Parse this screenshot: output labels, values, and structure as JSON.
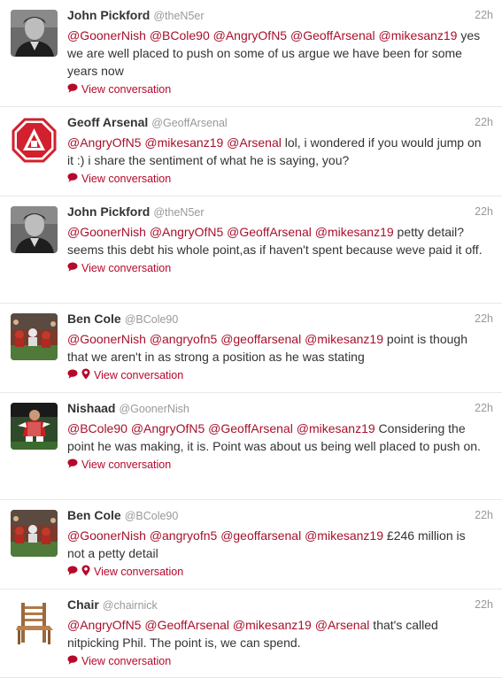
{
  "colors": {
    "accent": "#b6082b",
    "mention": "#a8102b",
    "meta": "#999999",
    "text": "#333333"
  },
  "footer_label": "View conversation",
  "tweets": [
    {
      "name": "John Pickford",
      "handle": "@theN5er",
      "time": "22h",
      "avatar": "player-bw-photo",
      "text": [
        [
          "m",
          "@GoonerNish"
        ],
        [
          "t",
          " "
        ],
        [
          "m",
          "@BCole90"
        ],
        [
          "t",
          " "
        ],
        [
          "m",
          "@AngryOfN5"
        ],
        [
          "t",
          " "
        ],
        [
          "m",
          "@GeoffArsenal"
        ],
        [
          "t",
          " "
        ],
        [
          "m",
          "@mikesanz19"
        ],
        [
          "t",
          " yes we are well placed to push on some of us argue we have been for some years now"
        ]
      ],
      "icons": [
        "conversation-icon"
      ]
    },
    {
      "name": "Geoff Arsenal",
      "handle": "@GeoffArsenal",
      "time": "22h",
      "avatar": "cannon-crest-logo",
      "text": [
        [
          "m",
          "@AngryOfN5"
        ],
        [
          "t",
          " "
        ],
        [
          "m",
          "@mikesanz19"
        ],
        [
          "t",
          " "
        ],
        [
          "m",
          "@Arsenal"
        ],
        [
          "t",
          " lol, i wondered if you would jump on it :) i share the sentiment of what he is saying, you?"
        ]
      ],
      "icons": [
        "conversation-icon"
      ]
    },
    {
      "name": "John Pickford",
      "handle": "@theN5er",
      "time": "22h",
      "avatar": "player-bw-photo",
      "text": [
        [
          "m",
          "@GoonerNish"
        ],
        [
          "t",
          " "
        ],
        [
          "m",
          "@AngryOfN5"
        ],
        [
          "t",
          " "
        ],
        [
          "m",
          "@GeoffArsenal"
        ],
        [
          "t",
          " "
        ],
        [
          "m",
          "@mikesanz19"
        ],
        [
          "t",
          " petty detail? seems this debt his whole point,as if haven't spent because weve paid it off."
        ]
      ],
      "icons": [
        "conversation-icon"
      ]
    },
    {
      "name": "Ben Cole",
      "handle": "@BCole90",
      "time": "22h",
      "avatar": "stadium-crowd-photo",
      "text": [
        [
          "m",
          "@GoonerNish"
        ],
        [
          "t",
          " "
        ],
        [
          "m",
          "@angryofn5"
        ],
        [
          "t",
          " "
        ],
        [
          "m",
          "@geoffarsenal"
        ],
        [
          "t",
          " "
        ],
        [
          "m",
          "@mikesanz19"
        ],
        [
          "t",
          " point is though that we aren't in as strong a position as he was stating"
        ]
      ],
      "icons": [
        "conversation-icon",
        "location-pin-icon"
      ]
    },
    {
      "name": "Nishaad",
      "handle": "@GoonerNish",
      "time": "22h",
      "avatar": "player-red-kit-photo",
      "text": [
        [
          "m",
          "@BCole90"
        ],
        [
          "t",
          " "
        ],
        [
          "m",
          "@AngryOfN5"
        ],
        [
          "t",
          " "
        ],
        [
          "m",
          "@GeoffArsenal"
        ],
        [
          "t",
          " "
        ],
        [
          "m",
          "@mikesanz19"
        ],
        [
          "t",
          " Considering the point he was making, it is. Point was about us being well placed to push on."
        ]
      ],
      "icons": [
        "conversation-icon"
      ]
    },
    {
      "name": "Ben Cole",
      "handle": "@BCole90",
      "time": "22h",
      "avatar": "stadium-crowd-photo",
      "text": [
        [
          "m",
          "@GoonerNish"
        ],
        [
          "t",
          " "
        ],
        [
          "m",
          "@angryofn5"
        ],
        [
          "t",
          " "
        ],
        [
          "m",
          "@geoffarsenal"
        ],
        [
          "t",
          " "
        ],
        [
          "m",
          "@mikesanz19"
        ],
        [
          "t",
          " £246 million is not a petty detail"
        ]
      ],
      "icons": [
        "conversation-icon",
        "location-pin-icon"
      ]
    },
    {
      "name": "Chair",
      "handle": "@chairnick",
      "time": "22h",
      "avatar": "wooden-chair-photo",
      "text": [
        [
          "m",
          "@AngryOfN5"
        ],
        [
          "t",
          " "
        ],
        [
          "m",
          "@GeoffArsenal"
        ],
        [
          "t",
          " "
        ],
        [
          "m",
          "@mikesanz19"
        ],
        [
          "t",
          " "
        ],
        [
          "m",
          "@Arsenal"
        ],
        [
          "t",
          " that's called nitpicking Phil. The point is, we can spend."
        ]
      ],
      "icons": [
        "conversation-icon"
      ]
    }
  ]
}
